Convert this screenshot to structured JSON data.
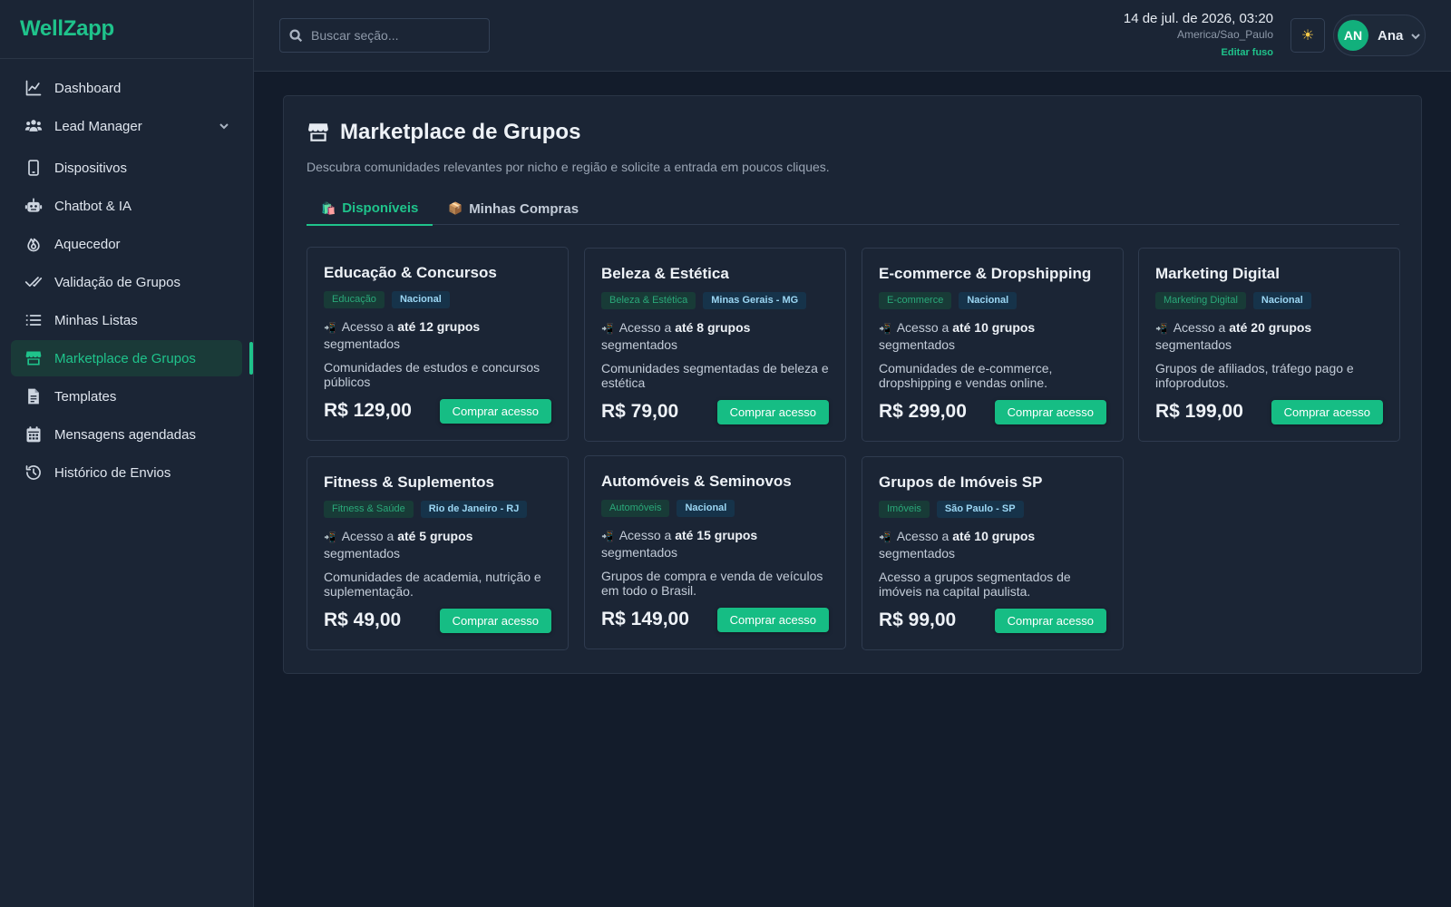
{
  "app": {
    "logo": "WellZapp"
  },
  "sidebar": {
    "items": [
      {
        "label": "Dashboard"
      },
      {
        "label": "Lead Manager"
      },
      {
        "label": "Dispositivos"
      },
      {
        "label": "Chatbot & IA"
      },
      {
        "label": "Aquecedor"
      },
      {
        "label": "Validação de Grupos"
      },
      {
        "label": "Minhas Listas"
      },
      {
        "label": "Marketplace de Grupos"
      },
      {
        "label": "Templates"
      },
      {
        "label": "Mensagens agendadas"
      },
      {
        "label": "Histórico de Envios"
      }
    ]
  },
  "header": {
    "search_placeholder": "Buscar seção...",
    "datetime": "14 de jul. de 2026, 03:20",
    "timezone": "America/Sao_Paulo",
    "edit_timezone": "Editar fuso",
    "theme_icon": "☀",
    "user": {
      "initials": "AN",
      "name": "Ana"
    }
  },
  "page": {
    "title": "Marketplace de Grupos",
    "subtitle": "Descubra comunidades relevantes por nicho e região e solicite a entrada em poucos cliques.",
    "tabs": [
      {
        "icon": "🛍️",
        "label": "Disponíveis"
      },
      {
        "icon": "📦",
        "label": "Minhas Compras"
      }
    ]
  },
  "cards": [
    {
      "title": "Educação & Concursos",
      "niche": "Educação",
      "region": "Nacional",
      "access_prefix": "Acesso a",
      "access_count": "até 12 grupos",
      "access_suffix": "segmentados",
      "description": "Comunidades de estudos e concursos públicos",
      "price": "R$ 129,00",
      "button": "Comprar acesso"
    },
    {
      "title": "Beleza & Estética",
      "niche": "Beleza & Estética",
      "region": "Minas Gerais - MG",
      "access_prefix": "Acesso a",
      "access_count": "até 8 grupos",
      "access_suffix": "segmentados",
      "description": "Comunidades segmentadas de beleza e estética",
      "price": "R$ 79,00",
      "button": "Comprar acesso"
    },
    {
      "title": "E-commerce & Dropshipping",
      "niche": "E-commerce",
      "region": "Nacional",
      "access_prefix": "Acesso a",
      "access_count": "até 10 grupos",
      "access_suffix": "segmentados",
      "description": "Comunidades de e-commerce, dropshipping e vendas online.",
      "price": "R$ 299,00",
      "button": "Comprar acesso"
    },
    {
      "title": "Marketing Digital",
      "niche": "Marketing Digital",
      "region": "Nacional",
      "access_prefix": "Acesso a",
      "access_count": "até 20 grupos",
      "access_suffix": "segmentados",
      "description": "Grupos de afiliados, tráfego pago e infoprodutos.",
      "price": "R$ 199,00",
      "button": "Comprar acesso"
    },
    {
      "title": "Fitness & Suplementos",
      "niche": "Fitness & Saúde",
      "region": "Rio de Janeiro - RJ",
      "access_prefix": "Acesso a",
      "access_count": "até 5 grupos",
      "access_suffix": "segmentados",
      "description": "Comunidades de academia, nutrição e suplementação.",
      "price": "R$ 49,00",
      "button": "Comprar acesso"
    },
    {
      "title": "Automóveis & Seminovos",
      "niche": "Automóveis",
      "region": "Nacional",
      "access_prefix": "Acesso a",
      "access_count": "até 15 grupos",
      "access_suffix": "segmentados",
      "description": "Grupos de compra e venda de veículos em todo o Brasil.",
      "price": "R$ 149,00",
      "button": "Comprar acesso"
    },
    {
      "title": "Grupos de Imóveis SP",
      "niche": "Imóveis",
      "region": "São Paulo - SP",
      "access_prefix": "Acesso a",
      "access_count": "até 10 grupos",
      "access_suffix": "segmentados",
      "description": "Acesso a grupos segmentados de imóveis na capital paulista.",
      "price": "R$ 99,00",
      "button": "Comprar acesso"
    }
  ],
  "colors": {
    "accent": "#1fc38b",
    "background": "#131c2b",
    "surface": "#1b2535"
  }
}
